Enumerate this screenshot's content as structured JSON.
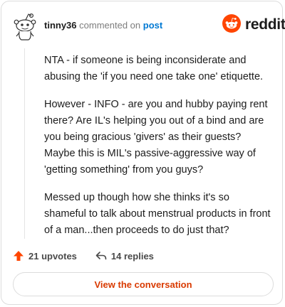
{
  "header": {
    "username": "tinny36",
    "action_text": "commented on",
    "post_link": "post"
  },
  "brand": {
    "name": "reddit",
    "accent_color": "#ff4500"
  },
  "comment": {
    "paragraphs": [
      "NTA - if someone is being inconsiderate and abusing the 'if you need one take one' etiquette.",
      "However - INFO - are you and hubby paying rent there? Are IL's helping you out of a bind and are you being gracious 'givers' as their guests? Maybe this is MIL's passive-aggressive way of 'getting something' from you guys?",
      "Messed up though how she thinks it's so shameful to talk about menstrual products in front of a man...then proceeds to do just that?"
    ]
  },
  "actions": {
    "upvotes": "21 upvotes",
    "replies": "14 replies",
    "upvote_icon": "upvote-arrow-icon",
    "reply_icon": "reply-arrow-icon"
  },
  "cta": {
    "label": "View the conversation",
    "color": "#d93a00"
  }
}
